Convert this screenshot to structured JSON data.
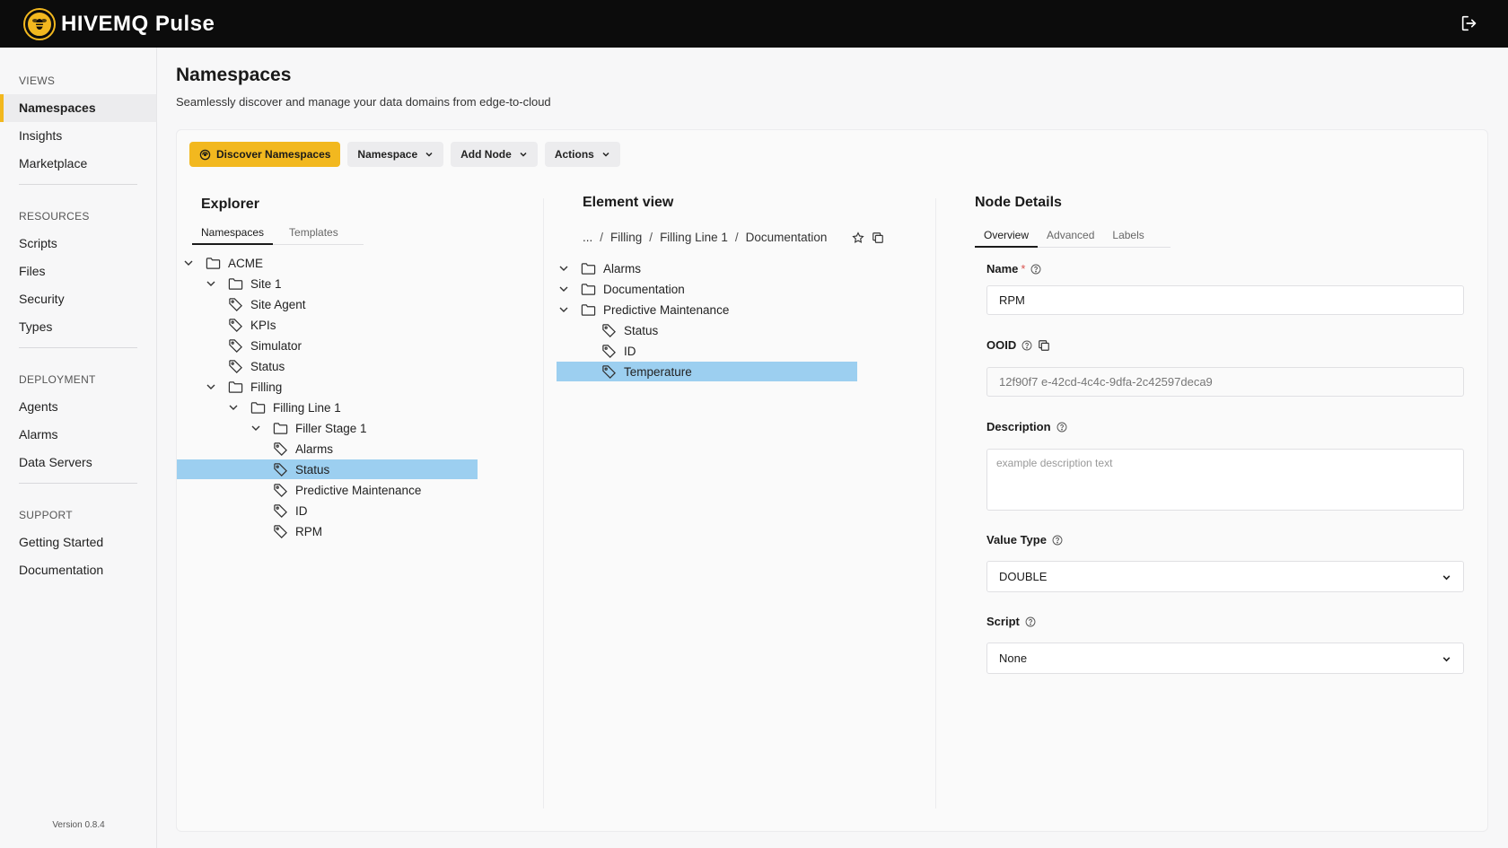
{
  "app": {
    "brand": "HIVEMQ",
    "product": "Pulse"
  },
  "colors": {
    "accent": "#f2b81f",
    "selection": "#9ccff0",
    "topbar": "#0c0c0c"
  },
  "sidebar": {
    "sections": [
      {
        "title": "VIEWS",
        "items": [
          {
            "label": "Namespaces"
          },
          {
            "label": "Insights"
          },
          {
            "label": "Marketplace"
          }
        ]
      },
      {
        "title": "RESOURCES",
        "items": [
          {
            "label": "Scripts"
          },
          {
            "label": "Files"
          },
          {
            "label": "Security"
          },
          {
            "label": "Types"
          }
        ]
      },
      {
        "title": "DEPLOYMENT",
        "items": [
          {
            "label": "Agents"
          },
          {
            "label": "Alarms"
          },
          {
            "label": "Data Servers"
          }
        ]
      },
      {
        "title": "SUPPORT",
        "items": [
          {
            "label": "Getting Started"
          },
          {
            "label": "Documentation"
          }
        ]
      }
    ],
    "active_item": "Namespaces",
    "version": "Version 0.8.4"
  },
  "page": {
    "title": "Namespaces",
    "subtitle": "Seamlessly discover and manage your data domains from edge-to-cloud"
  },
  "toolbar": {
    "discover": "Discover Namespaces",
    "namespace": "Namespace",
    "add_node": "Add Node",
    "actions": "Actions"
  },
  "explorer": {
    "title": "Explorer",
    "tabs": [
      "Namespaces",
      "Templates"
    ],
    "active_tab": "Namespaces",
    "tree": [
      {
        "label": "ACME",
        "kind": "folder",
        "expanded": true
      },
      {
        "label": "Site 1",
        "kind": "folder",
        "expanded": true
      },
      {
        "label": "Site Agent",
        "kind": "tag"
      },
      {
        "label": "KPIs",
        "kind": "tag"
      },
      {
        "label": "Simulator",
        "kind": "tag"
      },
      {
        "label": "Status",
        "kind": "tag"
      },
      {
        "label": "Filling",
        "kind": "folder",
        "expanded": true
      },
      {
        "label": "Filling Line 1",
        "kind": "folder",
        "expanded": true
      },
      {
        "label": "Filler Stage 1",
        "kind": "folder",
        "expanded": true
      },
      {
        "label": "Alarms",
        "kind": "tag"
      },
      {
        "label": "Status",
        "kind": "tag",
        "selected": true
      },
      {
        "label": "Predictive Maintenance",
        "kind": "tag"
      },
      {
        "label": "ID",
        "kind": "tag"
      },
      {
        "label": "RPM",
        "kind": "tag"
      }
    ]
  },
  "element_view": {
    "title": "Element view",
    "breadcrumb": [
      "...",
      "Filling",
      "Filling Line 1",
      "Documentation"
    ],
    "tree": [
      {
        "label": "Alarms",
        "kind": "folder",
        "expanded": true
      },
      {
        "label": "Documentation",
        "kind": "folder",
        "expanded": true
      },
      {
        "label": "Predictive Maintenance",
        "kind": "folder",
        "expanded": true
      },
      {
        "label": "Status",
        "kind": "tag"
      },
      {
        "label": "ID",
        "kind": "tag"
      },
      {
        "label": "Temperature",
        "kind": "tag",
        "selected": true
      }
    ]
  },
  "node_details": {
    "title": "Node Details",
    "tabs": [
      "Overview",
      "Advanced",
      "Labels"
    ],
    "active_tab": "Overview",
    "name_label": "Name",
    "required_mark": "*",
    "name_value": "RPM",
    "ooid_label": "OOID",
    "ooid_value": "12f90f7 e-42cd-4c4c-9dfa-2c42597deca9",
    "description_label": "Description",
    "description_placeholder": "example description text",
    "value_type_label": "Value Type",
    "value_type_value": "DOUBLE",
    "script_label": "Script",
    "script_value": "None"
  }
}
